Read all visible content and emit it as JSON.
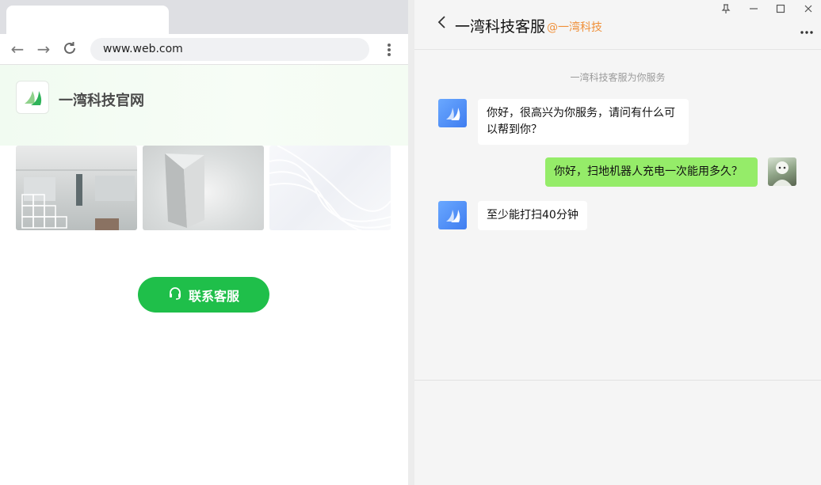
{
  "browser": {
    "url": "www.web.com",
    "site_title": "一湾科技官网",
    "contact_button": "联系客服"
  },
  "chat": {
    "title": "一湾科技客服",
    "subtitle": "@一湾科技",
    "system_message": "一湾科技客服为你服务",
    "messages": [
      {
        "from": "bot",
        "text": "你好，很高兴为你服务，请问有什么可以帮到你？"
      },
      {
        "from": "user",
        "text": "你好，扫地机器人充电一次能用多久？"
      },
      {
        "from": "bot",
        "text": "至少能打扫40分钟"
      }
    ]
  },
  "colors": {
    "accent_green": "#1fbf4a",
    "bubble_user": "#95ec69",
    "subtitle_orange": "#f0903a",
    "bot_avatar": "#4a8af4"
  },
  "icons": [
    "back-arrow-icon",
    "forward-arrow-icon",
    "reload-icon",
    "kebab-menu-icon",
    "headset-icon",
    "chevron-left-icon",
    "pin-icon",
    "minimize-icon",
    "maximize-icon",
    "close-icon",
    "more-icon"
  ]
}
